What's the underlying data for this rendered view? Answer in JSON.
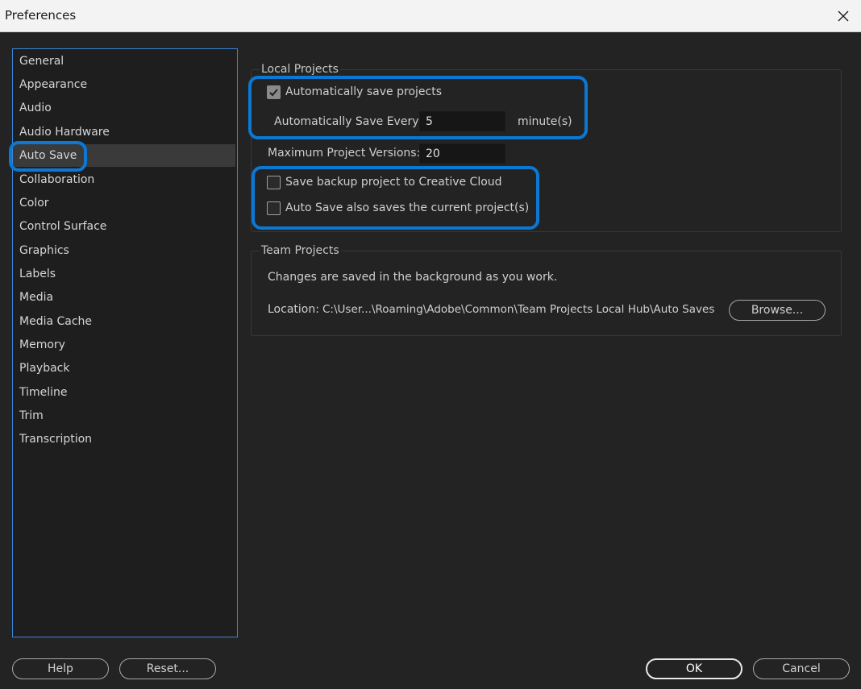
{
  "window": {
    "title": "Preferences",
    "close_icon": "close-icon"
  },
  "sidebar": {
    "items": [
      {
        "label": "General"
      },
      {
        "label": "Appearance"
      },
      {
        "label": "Audio"
      },
      {
        "label": "Audio Hardware"
      },
      {
        "label": "Auto Save",
        "selected": true
      },
      {
        "label": "Collaboration"
      },
      {
        "label": "Color"
      },
      {
        "label": "Control Surface"
      },
      {
        "label": "Graphics"
      },
      {
        "label": "Labels"
      },
      {
        "label": "Media"
      },
      {
        "label": "Media Cache"
      },
      {
        "label": "Memory"
      },
      {
        "label": "Playback"
      },
      {
        "label": "Timeline"
      },
      {
        "label": "Trim"
      },
      {
        "label": "Transcription"
      }
    ]
  },
  "local_projects": {
    "label": "Local Projects",
    "auto_save": {
      "label": "Automatically save projects",
      "checked": true
    },
    "save_every": {
      "label": "Automatically Save Every:",
      "value": "5",
      "unit": "minute(s)"
    },
    "max_versions": {
      "label": "Maximum Project Versions:",
      "value": "20"
    },
    "backup_cc": {
      "label": "Save backup project to Creative Cloud",
      "checked": false
    },
    "save_current": {
      "label": "Auto Save also saves the current project(s)",
      "checked": false
    }
  },
  "team_projects": {
    "label": "Team Projects",
    "description": "Changes are saved in the background as you work.",
    "location_label": "Location:",
    "location_path": "C:\\User...\\Roaming\\Adobe\\Common\\Team Projects Local Hub\\Auto Saves",
    "browse_label": "Browse..."
  },
  "footer": {
    "help_label": "Help",
    "reset_label": "Reset...",
    "ok_label": "OK",
    "cancel_label": "Cancel"
  },
  "colors": {
    "accent": "#0b78d4",
    "background": "#232323",
    "selection": "#3a3a3a"
  }
}
